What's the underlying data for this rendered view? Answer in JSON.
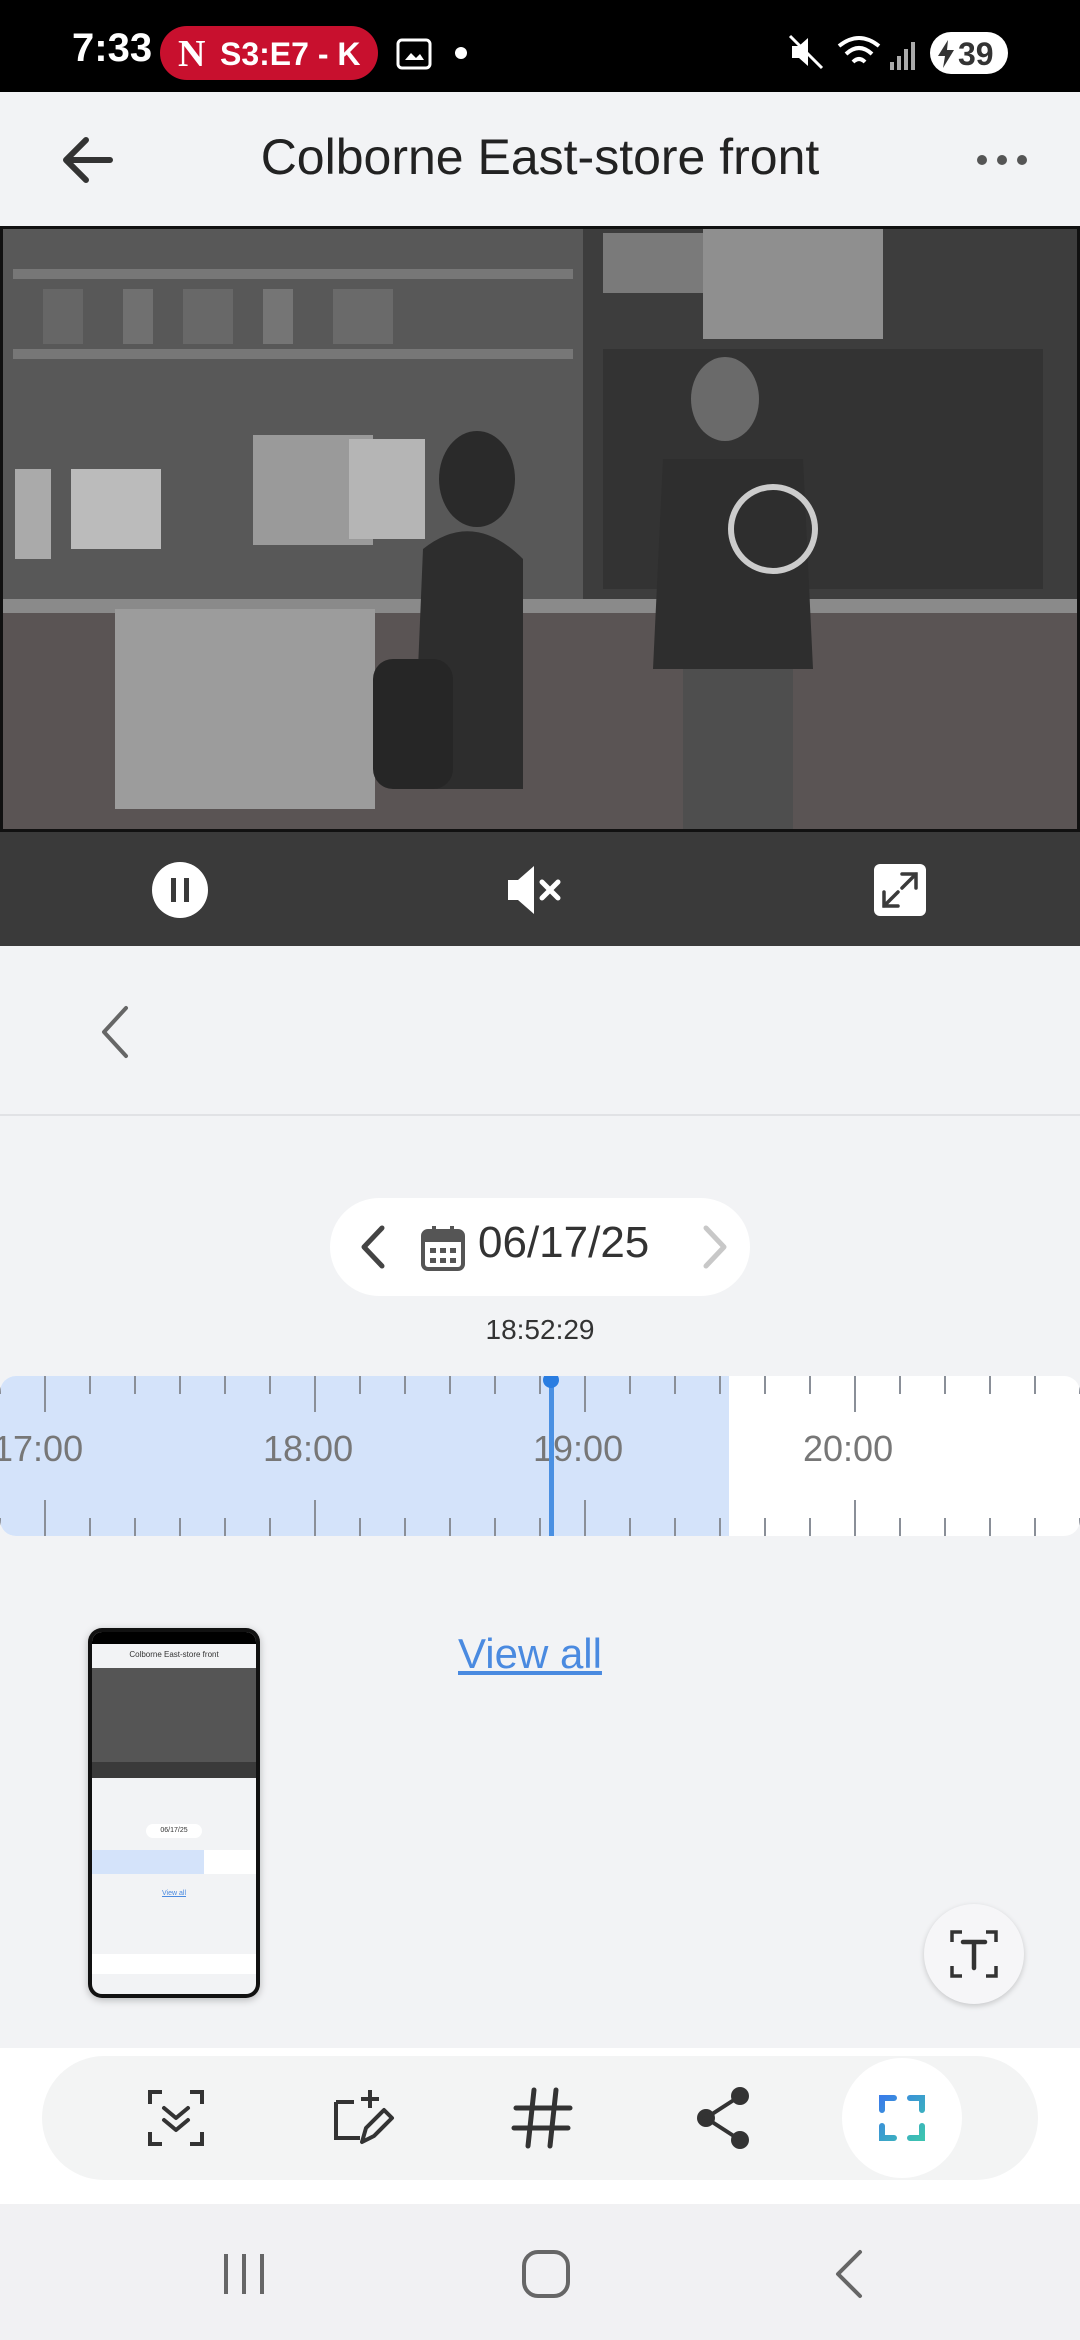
{
  "status_bar": {
    "time": "7:33",
    "media_badge": "S3:E7 - K",
    "battery": "39",
    "icons": [
      "netflix-icon",
      "screenshot-icon",
      "notification-dot-icon",
      "mute-icon",
      "wifi-icon",
      "signal-icon",
      "battery-icon"
    ]
  },
  "header": {
    "title": "Colborne East-store front",
    "back_icon": "back-arrow-icon",
    "more_icon": "more-icon"
  },
  "video_controls": {
    "icons": [
      "pause-icon",
      "mute-icon",
      "fullscreen-icon"
    ]
  },
  "date_picker": {
    "date": "06/17/25",
    "icons": [
      "chevron-left-icon",
      "calendar-icon",
      "chevron-right-icon"
    ]
  },
  "timeline": {
    "current_time": "18:52:29",
    "hour_labels": [
      "17:00",
      "18:00",
      "19:00",
      "20:00"
    ],
    "recorded_until": "19:32",
    "playhead": "18:52:29"
  },
  "events": {
    "view_all": "View all"
  },
  "thumbnail": {
    "title": "Colborne East-store front",
    "date": "06/17/25",
    "view_all": "View all"
  },
  "toolbar": {
    "icons": [
      "scroll-capture-icon",
      "draw-icon",
      "hashtag-icon",
      "share-icon",
      "crop-icon"
    ],
    "text_icon": "text-extract-icon"
  },
  "navbar": {
    "icons": [
      "recents-icon",
      "home-icon",
      "back-icon"
    ]
  }
}
